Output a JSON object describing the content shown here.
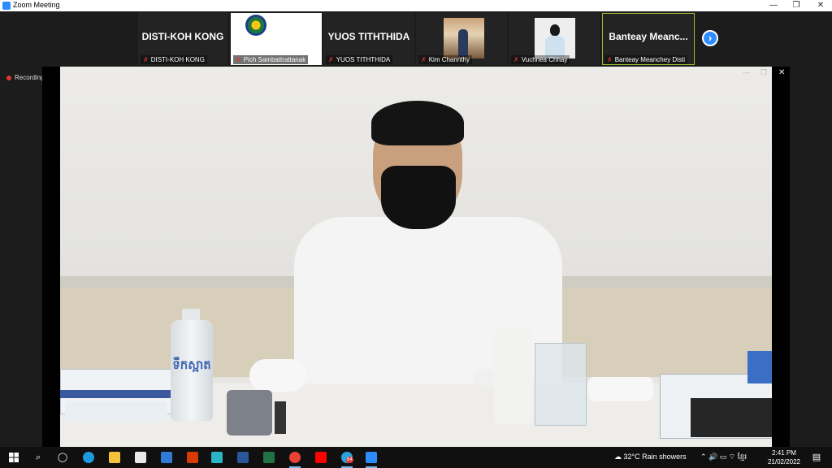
{
  "window": {
    "title": "Zoom Meeting",
    "controls": {
      "minimize": "—",
      "maximize": "❐",
      "close": "✕"
    }
  },
  "gallery": [
    {
      "big_name": "DISTI-KOH KONG",
      "label": "DISTI-KOH KONG",
      "kind": "name"
    },
    {
      "big_name": "",
      "label": "Pich Sambattrattanak",
      "kind": "logo"
    },
    {
      "big_name": "YUOS TITHTHIDA",
      "label": "YUOS TITHTHIDA",
      "kind": "name"
    },
    {
      "big_name": "",
      "label": "Kim Channthy",
      "kind": "photo"
    },
    {
      "big_name": "",
      "label": "Vuchnea Chhay",
      "kind": "photo"
    },
    {
      "big_name": "Banteay Meanc...",
      "label": "Banteay Meanchey Disti",
      "kind": "name",
      "active": true
    }
  ],
  "next_button": "›",
  "recording_label": "Recording",
  "main_video": {
    "bottle_label": "ទឹកស្អាត",
    "controls": {
      "minimize": "—",
      "maximize": "❐",
      "close": "✕"
    }
  },
  "taskbar": {
    "weather": "32°C  Rain showers",
    "time": "2:41 PM",
    "date": "21/02/2022",
    "telegram_badge": "64",
    "tray_icons": "⌃  🔊  ▭  ⌔  ខ្មែរ"
  },
  "colors": {
    "zoom_blue": "#2d8cff",
    "mic_muted": "#e0372f",
    "active_speaker": "#9bbf36"
  }
}
